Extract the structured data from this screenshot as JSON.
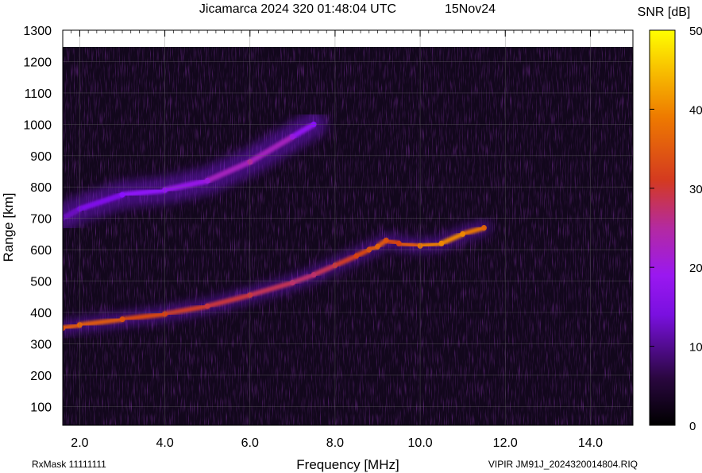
{
  "chart_data": {
    "type": "heatmap",
    "title": "Jicamarca 2024 320 01:48:04 UTC",
    "date_label": "15Nov24",
    "xlabel": "Frequency [MHz]",
    "ylabel": "Range [km]",
    "xlim": [
      1.6,
      15.0
    ],
    "ylim": [
      40,
      1300
    ],
    "x_ticks": [
      "2.0",
      "4.0",
      "6.0",
      "8.0",
      "10.0",
      "12.0",
      "14.0"
    ],
    "x_tick_values": [
      2,
      4,
      6,
      8,
      10,
      12,
      14
    ],
    "y_ticks": [
      "100",
      "200",
      "300",
      "400",
      "500",
      "600",
      "700",
      "800",
      "900",
      "1000",
      "1100",
      "1200",
      "1300"
    ],
    "y_tick_values": [
      100,
      200,
      300,
      400,
      500,
      600,
      700,
      800,
      900,
      1000,
      1100,
      1200,
      1300
    ],
    "grid": true,
    "colorbar": {
      "label": "SNR [dB]",
      "range": [
        0,
        50
      ],
      "ticks": [
        "0",
        "10",
        "20",
        "30",
        "40",
        "50"
      ],
      "tick_values": [
        0,
        10,
        20,
        30,
        40,
        50
      ],
      "colors": [
        "#000000",
        "#3a0a5a",
        "#8a10ff",
        "#b02a9a",
        "#d84010",
        "#f08a00",
        "#ffff00"
      ]
    },
    "traces": [
      {
        "x": [
          1.6,
          2.0,
          3.0,
          4.0,
          5.0,
          6.0,
          7.0,
          7.5,
          8.0,
          8.5,
          8.8,
          9.0,
          9.2,
          9.5,
          10.0,
          10.5,
          11.0,
          11.5
        ],
        "y": [
          350,
          360,
          378,
          395,
          420,
          455,
          495,
          520,
          550,
          580,
          600,
          610,
          630,
          620,
          612,
          620,
          650,
          670
        ],
        "snr": [
          30,
          32,
          30,
          28,
          26,
          26,
          24,
          24,
          26,
          28,
          30,
          32,
          30,
          28,
          34,
          36,
          36,
          32
        ]
      },
      {
        "x": [
          1.6,
          2.0,
          3.0,
          4.0,
          5.0,
          6.0,
          7.0,
          7.5
        ],
        "y": [
          700,
          730,
          775,
          790,
          820,
          880,
          960,
          1000
        ],
        "snr": [
          14,
          15,
          16,
          17,
          18,
          22,
          18,
          16
        ]
      }
    ]
  },
  "footer": {
    "rx_mask": "RxMask 11111111",
    "file_name": "VIPIR  JM91J_2024320014804.RIQ"
  }
}
